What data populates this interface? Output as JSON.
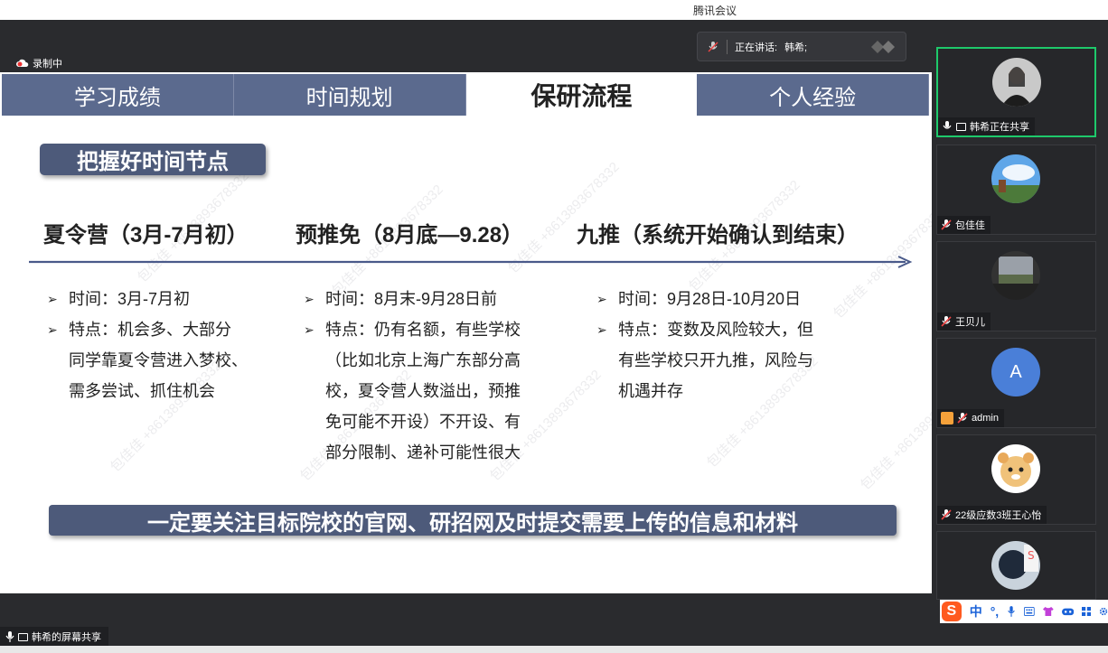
{
  "window": {
    "title": "腾讯会议"
  },
  "meeting": {
    "recording_label": "录制中",
    "speaking_label": "正在讲话:",
    "speaking_name": "韩希;",
    "screen_share_label": "韩希的屏幕共享"
  },
  "slide": {
    "tabs": [
      {
        "label": "学习成绩",
        "active": false
      },
      {
        "label": "时间规划",
        "active": false
      },
      {
        "label": "保研流程",
        "active": true
      },
      {
        "label": "个人经验",
        "active": false
      }
    ],
    "section_title": "把握好时间节点",
    "phases": [
      {
        "title": "夏令营（3月-7月初）",
        "time": "时间：3月-7月初",
        "feature_lines": [
          "特点：机会多、大部分",
          "同学靠夏令营进入梦校、",
          "需多尝试、抓住机会"
        ]
      },
      {
        "title": "预推免（8月底—9.28）",
        "time": "时间：8月末-9月28日前",
        "feature_lines": [
          "特点：仍有名额，有些学校",
          "（比如北京上海广东部分高",
          "校，夏令营人数溢出，预推",
          "免可能不开设）不开设、有",
          "部分限制、递补可能性很大"
        ]
      },
      {
        "title": "九推（系统开始确认到结束）",
        "time": "时间：9月28日-10月20日",
        "feature_lines": [
          "特点：变数及风险较大，但",
          "有些学校只开九推，风险与",
          "机遇并存"
        ]
      }
    ],
    "bottom_banner": "一定要关注目标院校的官网、研招网及时提交需要上传的信息和材料",
    "watermark": "包佳佳 +8613893678332"
  },
  "participants": [
    {
      "name": "韩希正在共享",
      "active": true,
      "mic": "on",
      "avatar": "photo-woman"
    },
    {
      "name": "包佳佳",
      "active": false,
      "mic": "muted",
      "avatar": "photo-landscape"
    },
    {
      "name": "王贝儿",
      "active": false,
      "mic": "muted",
      "avatar": "photo-window"
    },
    {
      "name": "admin",
      "active": false,
      "mic": "muted",
      "avatar_letter": "A",
      "avatar_color": "#4a7fd8"
    },
    {
      "name": "22级应数3班王心怡",
      "active": false,
      "mic": "muted",
      "avatar": "cartoon-bear"
    },
    {
      "name": "",
      "active": false,
      "mic": "muted",
      "avatar": "photo-person"
    }
  ],
  "ime_toolbar": {
    "logo": "S",
    "mode": "中",
    "punct": "°,",
    "icons": [
      "mic-icon",
      "keyboard-icon",
      "shirt-icon",
      "game-icon",
      "grid-icon",
      "settings-icon"
    ]
  },
  "colors": {
    "tab_bg": "#5b6a8e",
    "banner_bg": "#4d5a7a",
    "active_border": "#1ec96b",
    "timeline": "#4a5a8a"
  }
}
